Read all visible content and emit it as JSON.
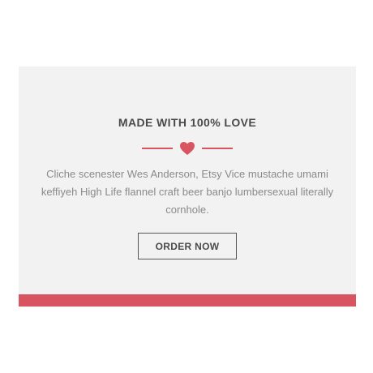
{
  "card": {
    "title": "MADE WITH 100% LOVE",
    "description": "Cliche scenester Wes Anderson, Etsy Vice mustache umami keffiyeh High Life flannel craft beer banjo lumbersexual literally cornhole.",
    "button_label": "ORDER NOW",
    "divider_icon": "heart-icon"
  },
  "colors": {
    "accent": "#d95461",
    "card_background": "#f2f2f2",
    "heading_text": "#4a4a4a",
    "body_text": "#8a8a8a"
  }
}
